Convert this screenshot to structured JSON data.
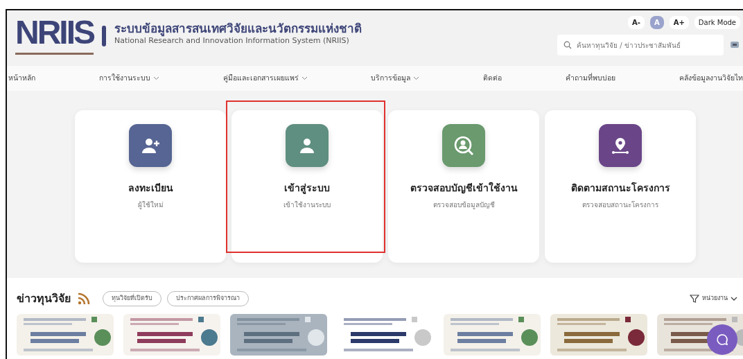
{
  "header": {
    "logo": "NRIIS",
    "title_th": "ระบบข้อมูลสารสนเทศวิจัยและนวัตกรรมแห่งชาติ",
    "title_en": "National Research and Innovation Information System (NRIIS)",
    "font_buttons": [
      {
        "label": "A-",
        "selected": false
      },
      {
        "label": "A",
        "selected": true
      },
      {
        "label": "A+",
        "selected": false
      }
    ],
    "dark_mode": "Dark Mode",
    "search": {
      "placeholder": "ค้นหาทุนวิจัย / ข่าวประชาสัมพันธ์"
    }
  },
  "nav": [
    {
      "label": "หน้าหลัก",
      "dropdown": false
    },
    {
      "label": "การใช้งานระบบ",
      "dropdown": true
    },
    {
      "label": "คู่มือและเอกสารเผยแพร่",
      "dropdown": true
    },
    {
      "label": "บริการข้อมูล",
      "dropdown": true
    },
    {
      "label": "ติดต่อ",
      "dropdown": false
    },
    {
      "label": "คำถามที่พบบ่อย",
      "dropdown": false
    },
    {
      "label": "คลังข้อมูลงานวิจัยไท",
      "dropdown": false
    }
  ],
  "cards": [
    {
      "kind": "register",
      "title": "ลงทะเบียน",
      "subtitle": "ผู้ใช้ใหม่",
      "color": "#566593",
      "highlighted": false
    },
    {
      "kind": "login",
      "title": "เข้าสู่ระบบ",
      "subtitle": "เข้าใช้งานระบบ",
      "color": "#5f8f80",
      "highlighted": true
    },
    {
      "kind": "check",
      "title": "ตรวจสอบบัญชีเข้าใช้งาน",
      "subtitle": "ตรวจสอบข้อมูลบัญชี",
      "color": "#6a9a6e",
      "highlighted": false
    },
    {
      "kind": "track",
      "title": "ติดตามสถานะโครงการ",
      "subtitle": "ตรวจสอบสถานะโครงการ",
      "color": "#6a4688",
      "highlighted": false
    }
  ],
  "news": {
    "title": "ข่าวทุนวิจัย",
    "filters": [
      {
        "label": "ทุนวิจัยที่เปิดรับ",
        "selected": false
      },
      {
        "label": "ประกาศผลการพิจารณา",
        "selected": false
      }
    ],
    "unit_filter": "หน่วยงาน"
  }
}
